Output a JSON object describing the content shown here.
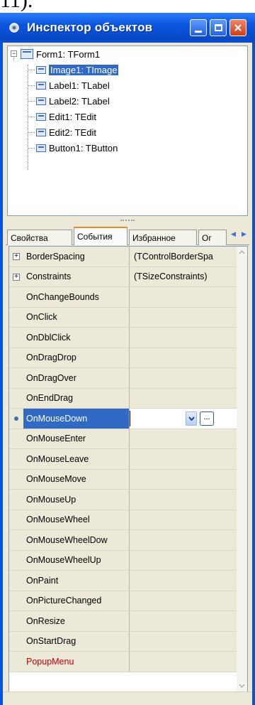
{
  "window": {
    "title": "Инспектор объектов"
  },
  "tree": {
    "root": "Form1: TForm1",
    "children": [
      "Image1: TImage",
      "Label1: TLabel",
      "Label2: TLabel",
      "Edit1: TEdit",
      "Edit2: TEdit",
      "Button1: TButton"
    ],
    "selected_index": 0
  },
  "tabs": [
    "Свойства",
    "События",
    "Избранное",
    "Ог"
  ],
  "active_tab": 1,
  "events": [
    {
      "name": "BorderSpacing",
      "value": "(TControlBorderSpa",
      "expandable": true
    },
    {
      "name": "Constraints",
      "value": "(TSizeConstraints)",
      "expandable": true
    },
    {
      "name": "OnChangeBounds",
      "value": ""
    },
    {
      "name": "OnClick",
      "value": ""
    },
    {
      "name": "OnDblClick",
      "value": ""
    },
    {
      "name": "OnDragDrop",
      "value": ""
    },
    {
      "name": "OnDragOver",
      "value": ""
    },
    {
      "name": "OnEndDrag",
      "value": ""
    },
    {
      "name": "OnMouseDown",
      "value": "",
      "selected": true
    },
    {
      "name": "OnMouseEnter",
      "value": ""
    },
    {
      "name": "OnMouseLeave",
      "value": ""
    },
    {
      "name": "OnMouseMove",
      "value": ""
    },
    {
      "name": "OnMouseUp",
      "value": ""
    },
    {
      "name": "OnMouseWheel",
      "value": ""
    },
    {
      "name": "OnMouseWheelDow",
      "value": ""
    },
    {
      "name": "OnMouseWheelUp",
      "value": ""
    },
    {
      "name": "OnPaint",
      "value": ""
    },
    {
      "name": "OnPictureChanged",
      "value": ""
    },
    {
      "name": "OnResize",
      "value": ""
    },
    {
      "name": "OnStartDrag",
      "value": ""
    },
    {
      "name": "PopupMenu",
      "value": "",
      "highlight": true
    }
  ],
  "editor": {
    "value": "",
    "ellipsis": "..."
  },
  "colors": {
    "title_bar": "#0a55e0",
    "selection": "#316ac5",
    "active_tab_accent": "#e68b2c",
    "reference_property": "#c00000"
  },
  "icons": [
    "app-icon",
    "minimize-icon",
    "maximize-icon",
    "close-icon",
    "tree-expand-icon",
    "component-icon",
    "dropdown-arrow-icon",
    "ellipsis-icon",
    "scroll-left-icon",
    "scroll-right-icon",
    "scroll-up-icon",
    "scroll-down-icon"
  ]
}
